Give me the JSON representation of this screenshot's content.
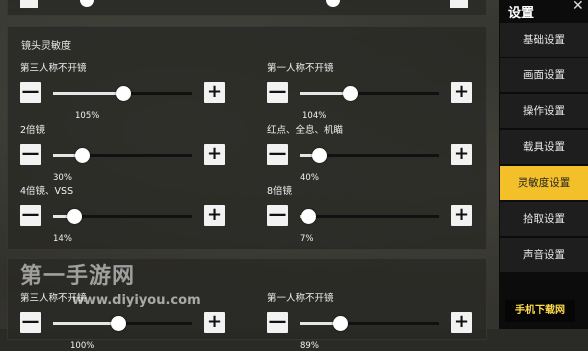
{
  "sidebar": {
    "title": "设置",
    "close": "✕",
    "items": [
      {
        "label": "基础设置",
        "active": false
      },
      {
        "label": "画面设置",
        "active": false
      },
      {
        "label": "操作设置",
        "active": false
      },
      {
        "label": "载具设置",
        "active": false
      },
      {
        "label": "灵敏度设置",
        "active": true
      },
      {
        "label": "拾取设置",
        "active": false
      },
      {
        "label": "声音设置",
        "active": false
      }
    ]
  },
  "section": {
    "title": "镜头灵敏度"
  },
  "sliders": [
    {
      "label": "第三人称不开镜",
      "value": "105%",
      "fraction": 0.5
    },
    {
      "label": "第一人称不开镜",
      "value": "104%",
      "fraction": 0.36
    },
    {
      "label": "2倍镜",
      "value": "30%",
      "fraction": 0.21
    },
    {
      "label": "红点、全息、机瞄",
      "value": "40%",
      "fraction": 0.14
    },
    {
      "label": "4倍镜、VSS",
      "value": "14%",
      "fraction": 0.15
    },
    {
      "label": "8倍镜",
      "value": "7%",
      "fraction": 0.06
    }
  ],
  "bottom_sliders": [
    {
      "label": "第三人称不开镜",
      "value": "100%",
      "fraction": 0.47
    },
    {
      "label": "第一人称不开镜",
      "value": "89%",
      "fraction": 0.29
    }
  ],
  "icons": {
    "minus": "—",
    "plus": "+"
  },
  "watermark": {
    "text": "第一手游网",
    "url": "www.diyiyou.com",
    "logo": "手机下载网"
  },
  "colors": {
    "accent": "#f3c02a",
    "sidebar_bg": "#0c0c0c"
  }
}
